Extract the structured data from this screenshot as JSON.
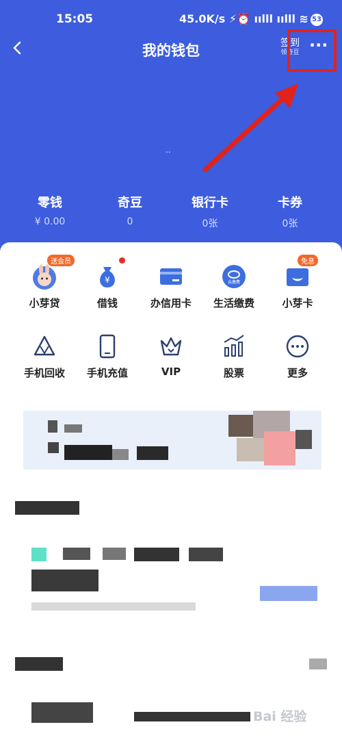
{
  "status": {
    "time": "15:05",
    "network": "45.0K/s ⚡⏰ ıılll ıılll ≋",
    "battery": "53"
  },
  "header": {
    "title": "我的钱包",
    "signin_main": "签到",
    "signin_sub": "领奇豆",
    "more_icon": "···"
  },
  "hero": {
    "dots": ".."
  },
  "balances": [
    {
      "label": "零钱",
      "value": "¥ 0.00"
    },
    {
      "label": "奇豆",
      "value": "0"
    },
    {
      "label": "银行卡",
      "value": "0张"
    },
    {
      "label": "卡券",
      "value": "0张"
    }
  ],
  "services_row1": [
    {
      "label": "小芽贷",
      "icon": "bunny-icon",
      "badge": "送会员"
    },
    {
      "label": "借钱",
      "icon": "money-bag-icon",
      "badge": ""
    },
    {
      "label": "办信用卡",
      "icon": "credit-card-icon",
      "badge": ""
    },
    {
      "label": "生活缴费",
      "icon": "utility-payment-icon",
      "badge": ""
    },
    {
      "label": "小芽卡",
      "icon": "sprout-card-icon",
      "badge": "免息"
    }
  ],
  "services_row2": [
    {
      "label": "手机回收",
      "icon": "recycle-icon"
    },
    {
      "label": "手机充值",
      "icon": "phone-icon"
    },
    {
      "label": "VIP",
      "icon": "crown-icon"
    },
    {
      "label": "股票",
      "icon": "stock-chart-icon"
    },
    {
      "label": "更多",
      "icon": "more-circle-icon"
    }
  ],
  "utility_icon_text": "云缴费",
  "watermark": "Bai 经验",
  "colors": {
    "brand": "#3d5cde",
    "annotation": "#e2231a",
    "badge": "#f06a2c"
  }
}
